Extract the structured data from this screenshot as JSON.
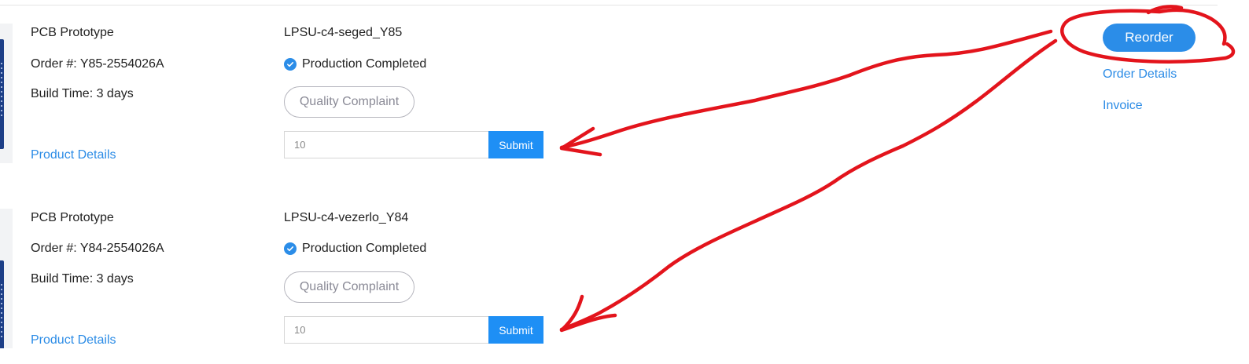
{
  "orders": [
    {
      "product": "PCB Prototype",
      "order_number": "Order #: Y85-2554026A",
      "build_time": "Build Time: 3 days",
      "product_details_link": "Product Details",
      "file_name": "LPSU-c4-seged_Y85",
      "status": "Production Completed",
      "complaint_label": "Quality Complaint",
      "quantity_value": "10",
      "submit_label": "Submit"
    },
    {
      "product": "PCB Prototype",
      "order_number": "Order #: Y84-2554026A",
      "build_time": "Build Time: 3 days",
      "product_details_link": "Product Details",
      "file_name": "LPSU-c4-vezerlo_Y84",
      "status": "Production Completed",
      "complaint_label": "Quality Complaint",
      "quantity_value": "10",
      "submit_label": "Submit"
    }
  ],
  "actions": {
    "reorder_label": "Reorder",
    "order_details_label": "Order Details",
    "invoice_label": "Invoice"
  },
  "icons": {
    "status": "check-circle-icon",
    "thumbnail": "pcb-board-icon"
  },
  "colors": {
    "accent": "#2b8de8",
    "link": "#2c8ce6",
    "submit": "#1e8ff5",
    "annotation": "#e3141c"
  }
}
